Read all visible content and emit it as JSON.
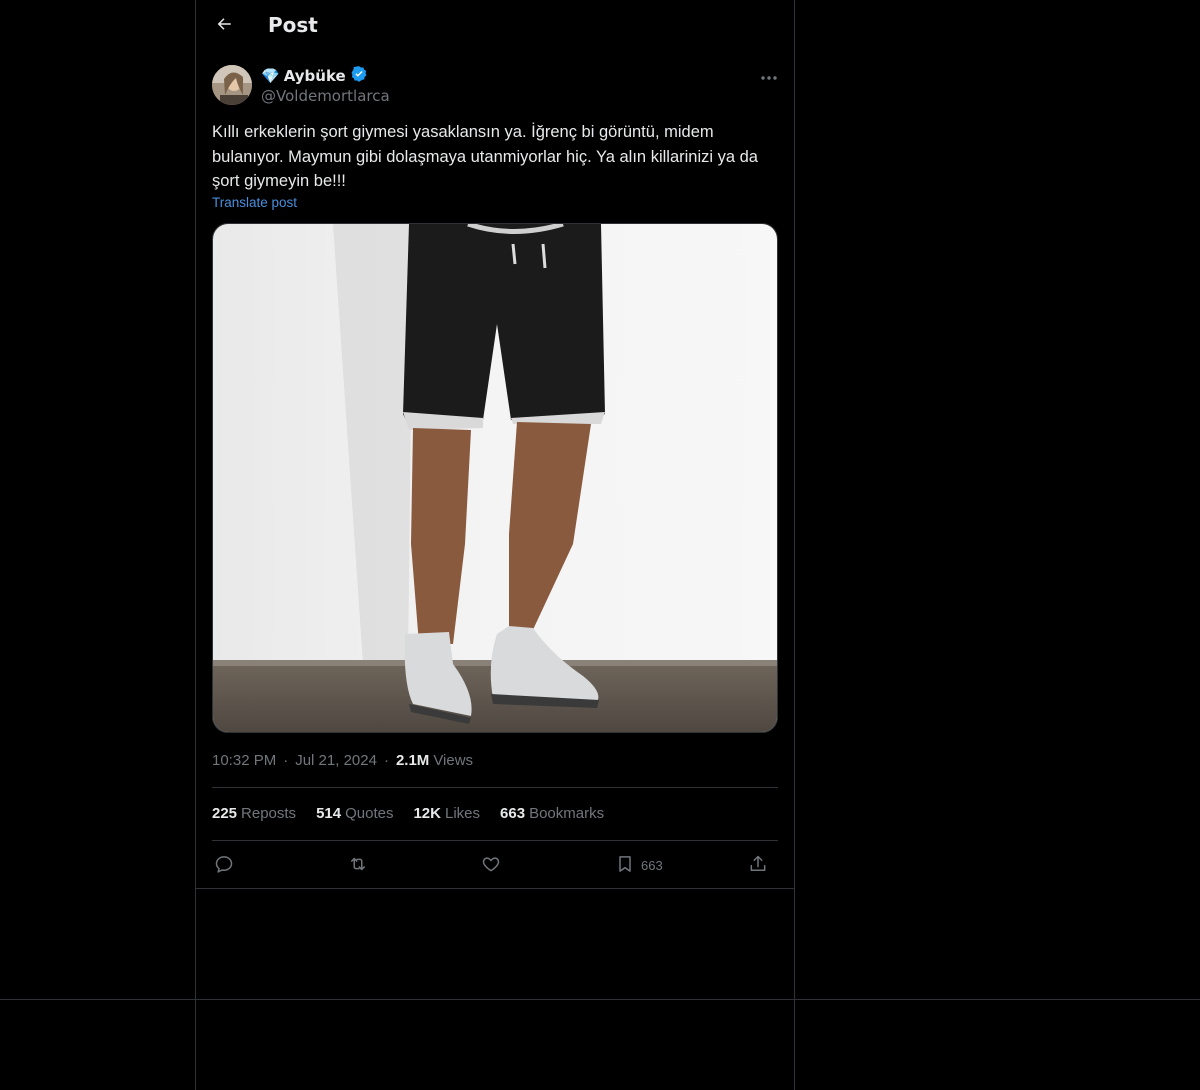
{
  "header": {
    "title": "Post",
    "back_icon": "arrow-left-icon"
  },
  "author": {
    "badge_emoji": "💎",
    "display_name": "Aybüke",
    "handle": "@Voldemortlarca",
    "verified_color": "#1d9bf0"
  },
  "tweet": {
    "text": "Kıllı erkeklerin şort giymesi yasaklansın ya. İğrenç bi görüntü, midem bulanıyor. Maymun gibi dolaşmaya utanmiyorlar hiç. Ya alın killarinizi ya da şort giymeyin be!!!",
    "translate_label": "Translate post"
  },
  "meta": {
    "time": "10:32 PM",
    "separator": "·",
    "date": "Jul 21, 2024",
    "views_count": "2.1M",
    "views_label": "Views"
  },
  "stats": [
    {
      "count": "225",
      "label": "Reposts"
    },
    {
      "count": "514",
      "label": "Quotes"
    },
    {
      "count": "12K",
      "label": "Likes"
    },
    {
      "count": "663",
      "label": "Bookmarks"
    }
  ],
  "actions": {
    "reply_icon": "reply-icon",
    "repost_icon": "repost-icon",
    "like_icon": "heart-icon",
    "bookmark_icon": "bookmark-icon",
    "bookmark_count": "663",
    "share_icon": "share-icon"
  },
  "colors": {
    "background": "#000000",
    "text": "#e7e9ea",
    "muted": "#71767b",
    "link": "#1d9bf0",
    "border": "#2f3336"
  }
}
